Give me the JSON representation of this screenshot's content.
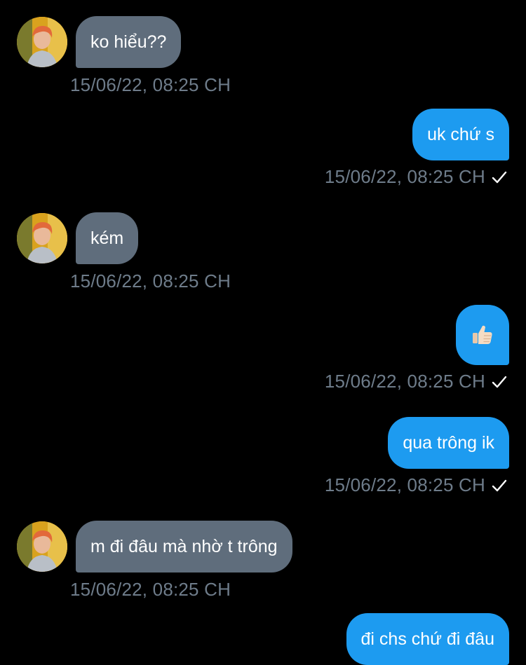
{
  "messages": [
    {
      "direction": "in",
      "text": "ko hiểu??",
      "time": "15/06/22, 08:25 CH",
      "avatar_icon": "user-avatar-photo"
    },
    {
      "direction": "out",
      "text": "uk chứ s",
      "time": "15/06/22, 08:25 CH",
      "status_icon": "sent-check-icon"
    },
    {
      "direction": "in",
      "text": "kém",
      "time": "15/06/22, 08:25 CH",
      "avatar_icon": "user-avatar-photo"
    },
    {
      "direction": "out",
      "text": "👍🏻",
      "time": "15/06/22, 08:25 CH",
      "status_icon": "sent-check-icon",
      "icon": "thumbs-up-emoji"
    },
    {
      "direction": "out",
      "text": "qua trông ik",
      "time": "15/06/22, 08:25 CH",
      "status_icon": "sent-check-icon"
    },
    {
      "direction": "in",
      "text": "m đi đâu mà nhờ t trông",
      "time": "15/06/22, 08:25 CH",
      "avatar_icon": "user-avatar-photo"
    },
    {
      "direction": "out",
      "text": "đi chs chứ đi đâu"
    }
  ],
  "colors": {
    "background": "#000000",
    "incoming_bubble": "#5f6d7c",
    "outgoing_bubble": "#1d9bf0",
    "timestamp": "#6e7c8a",
    "text": "#ffffff"
  }
}
